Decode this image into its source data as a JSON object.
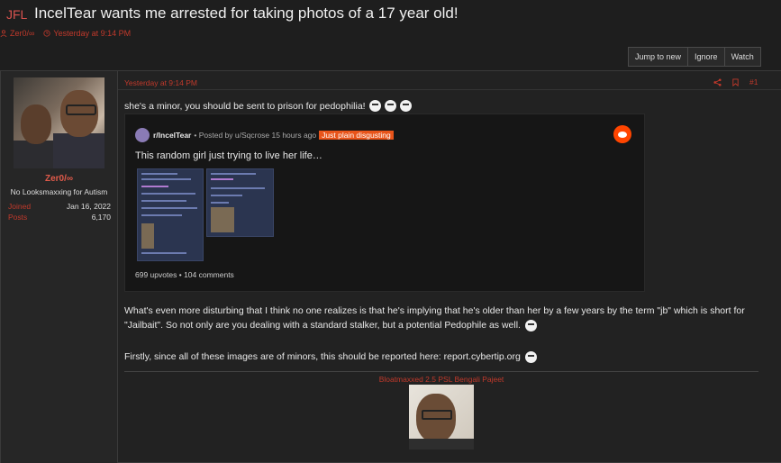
{
  "thread": {
    "prefix": "JFL",
    "title": "IncelTear wants me arrested for taking photos of a 17 year old!",
    "author": "Zer0/∞",
    "time": "Yesterday at 9:14 PM"
  },
  "actions": {
    "jump": "Jump to new",
    "ignore": "Ignore",
    "watch": "Watch"
  },
  "user": {
    "name": "Zer0/∞",
    "title": "No Looksmaxxing for Autism",
    "joined_label": "Joined",
    "joined": "Jan 16, 2022",
    "posts_label": "Posts",
    "posts": "6,170"
  },
  "post": {
    "date": "Yesterday at 9:14 PM",
    "number": "#1",
    "line1": "she's a minor, you should be sent to prison for pedophilia!",
    "para2": "What's even more disturbing that I think no one realizes is that he's implying that he's older than her by a few years by the term \"jb\" which is short for \"Jailbait\". So not only are you dealing with a standard stalker, but a potential Pedophile as well.",
    "para3": "Firstly, since all of these images are of minors, this should be reported here: report.cybertip.org"
  },
  "embed": {
    "subreddit": "r/IncelTear",
    "posted_by": "• Posted by u/Sqcrose 15 hours ago",
    "flair": "Just plain disgusting",
    "title": "This random girl just trying to live her life…",
    "upvotes": "699 upvotes",
    "sep": "•",
    "comments": "104 comments"
  },
  "signature": {
    "text": "Bloatmaxxed 2.5 PSL Bengali Pajeet"
  },
  "colors": {
    "accent": "#c0392b",
    "flair": "#e8541a",
    "reddit": "#ff4500"
  }
}
